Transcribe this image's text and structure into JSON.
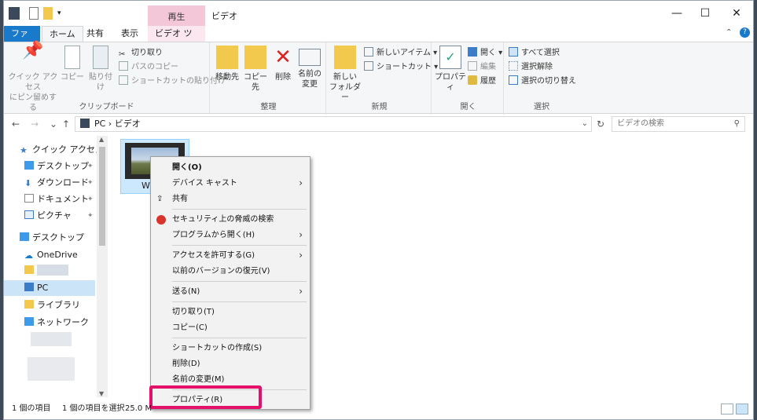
{
  "titlebar": {
    "context_tab_header": "再生",
    "title": "ビデオ",
    "minimize": "—",
    "maximize": "☐",
    "close": "✕"
  },
  "tabs": {
    "file": "ファイル",
    "home": "ホーム",
    "share": "共有",
    "view": "表示",
    "video_tools": "ビデオ ツール"
  },
  "ribbon": {
    "pin_quick_access": [
      "クイック アクセス",
      "にピン留めする"
    ],
    "copy": "コピー",
    "paste": "貼り付け",
    "cut": "切り取り",
    "copy_path": "パスのコピー",
    "paste_shortcut": "ショートカットの貼り付け",
    "clipboard_group": "クリップボード",
    "move_to": "移動先",
    "copy_to": "コピー先",
    "delete": "削除",
    "rename": [
      "名前の",
      "変更"
    ],
    "organize_group": "整理",
    "new_folder": [
      "新しい",
      "フォルダー"
    ],
    "new_item": "新しいアイテム ▾",
    "shortcut": "ショートカット ▾",
    "new_group": "新規",
    "properties": "プロパティ",
    "open": "開く ▾",
    "edit": "編集",
    "history": "履歴",
    "open_group": "開く",
    "select_all": "すべて選択",
    "select_none": "選択解除",
    "invert_selection": "選択の切り替え",
    "select_group": "選択"
  },
  "nav": {
    "back": "←",
    "forward": "→",
    "recent": "⌄",
    "up": "↑",
    "breadcrumb": "PC  ›  ビデオ",
    "refresh": "↻",
    "search_placeholder": "ビデオの検索"
  },
  "sidebar": {
    "quick_access": "クイック アクセス",
    "desktop_pinned": "デスクトップ",
    "downloads": "ダウンロード",
    "documents": "ドキュメント",
    "pictures": "ピクチャ",
    "desktop": "デスクトップ",
    "onedrive": "OneDrive",
    "pc": "PC",
    "libraries": "ライブラリ",
    "network": "ネットワーク"
  },
  "file": {
    "name": "W"
  },
  "context_menu": {
    "open": "開く(O)",
    "cast": "デバイス キャスト",
    "share": "共有",
    "scan": "セキュリティ上の脅威の検索",
    "open_with": "プログラムから開く(H)",
    "give_access": "アクセスを許可する(G)",
    "restore": "以前のバージョンの復元(V)",
    "send_to": "送る(N)",
    "cut": "切り取り(T)",
    "copy": "コピー(C)",
    "create_shortcut": "ショートカットの作成(S)",
    "delete": "削除(D)",
    "rename": "名前の変更(M)",
    "properties": "プロパティ(R)"
  },
  "status": {
    "count": "1 個の項目",
    "selected": "1 個の項目を選択",
    "size": "25.0 M"
  },
  "colors": {
    "accent": "#1979ca",
    "highlight": "#e4106a",
    "context_tab": "#f3c7d8"
  }
}
